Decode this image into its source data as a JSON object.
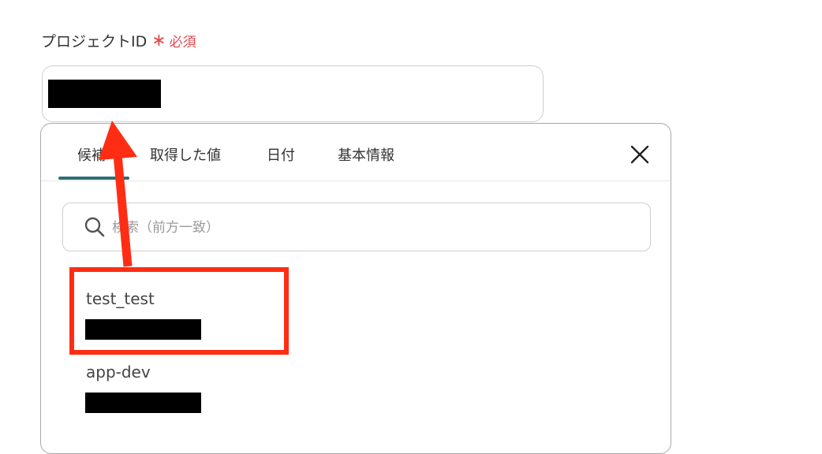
{
  "field": {
    "label": "プロジェクトID",
    "required_mark": "∗",
    "required_text": "必須"
  },
  "dropdown": {
    "tabs": [
      {
        "label": "候補",
        "active": true
      },
      {
        "label": "取得した値",
        "active": false
      },
      {
        "label": "日付",
        "active": false
      },
      {
        "label": "基本情報",
        "active": false
      }
    ],
    "search_placeholder": "検索（前方一致）",
    "options": [
      {
        "name": "test_test",
        "highlighted": true
      },
      {
        "name": "app-dev",
        "highlighted": false
      }
    ]
  },
  "colors": {
    "required": "#e5484d",
    "active_tab_underline": "#2c6f76",
    "annotation": "#ff2d14"
  },
  "icons": [
    "search-icon",
    "close-icon",
    "annotation-arrow"
  ]
}
